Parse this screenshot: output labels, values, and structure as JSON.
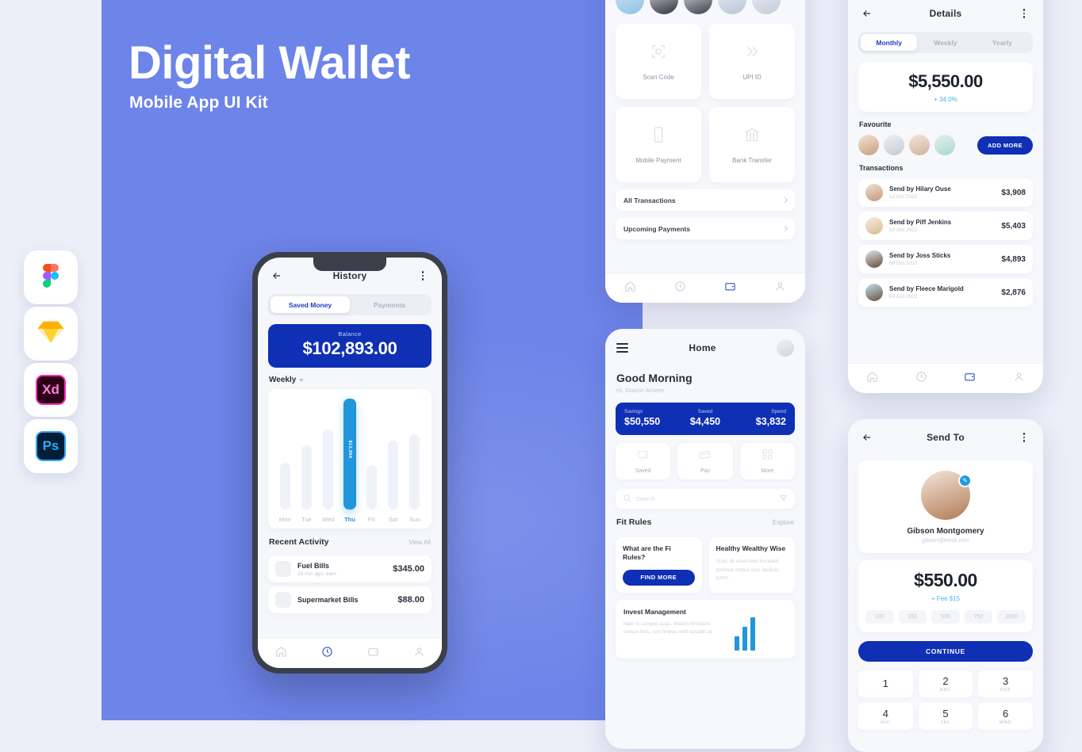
{
  "hero": {
    "title": "Digital Wallet",
    "subtitle": "Mobile App UI Kit",
    "bg_color": "#6d84e8",
    "accent_blue": "#0f2fb5",
    "accent_cyan": "#2196dd"
  },
  "tools": [
    {
      "name": "Figma",
      "icon": "figma-icon"
    },
    {
      "name": "Sketch",
      "icon": "sketch-icon"
    },
    {
      "name": "Adobe XD",
      "icon": "xd-icon",
      "label": "Xd"
    },
    {
      "name": "Photoshop",
      "icon": "photoshop-icon",
      "label": "Ps"
    }
  ],
  "history_screen": {
    "title": "History",
    "tabs": [
      {
        "label": "Saved Money",
        "active": true
      },
      {
        "label": "Payments",
        "active": false
      }
    ],
    "balance_label": "Balance",
    "balance_value": "$102,893.00",
    "period": "Weekly",
    "recent_title": "Recent Activity",
    "view_all": "View All",
    "activity": [
      {
        "name": "Fuel Bills",
        "sub": "24 min ago, earn",
        "amount": "$345.00"
      },
      {
        "name": "Supermarket Bills",
        "sub": "",
        "amount": "$88.00"
      }
    ],
    "nav": [
      "home-icon",
      "history-icon",
      "wallet-icon",
      "profile-icon"
    ],
    "active_nav": 1
  },
  "chart_data": {
    "type": "bar",
    "title": "Weekly",
    "categories": [
      "Mon",
      "Tue",
      "Wed",
      "Thu",
      "Fri",
      "Sat",
      "Sun"
    ],
    "values": [
      42,
      58,
      72,
      100,
      40,
      62,
      68
    ],
    "highlight_index": 3,
    "highlight_label": "$12,904",
    "xlabel": "",
    "ylabel": "",
    "grid": false,
    "legend": "none"
  },
  "payment_screen": {
    "tiles": [
      {
        "label": "Scan Code",
        "icon": "scan-code-icon"
      },
      {
        "label": "UPI ID",
        "icon": "chevrons-right-icon"
      },
      {
        "label": "Mobile Payment",
        "icon": "mobile-icon"
      },
      {
        "label": "Bank Transfer",
        "icon": "bank-icon"
      }
    ],
    "rows": [
      "All Transactions",
      "Upcoming Payments"
    ],
    "nav": [
      "home-icon",
      "history-icon",
      "wallet-icon",
      "profile-icon"
    ],
    "active_nav": 2
  },
  "home_screen": {
    "title": "Home",
    "greeting": "Good Morning",
    "user_line": "Hi, Dianne Ameter",
    "stats": [
      {
        "label": "Savings",
        "value": "$50,550"
      },
      {
        "label": "Saved",
        "value": "$4,450"
      },
      {
        "label": "Spend",
        "value": "$3,832"
      }
    ],
    "actions": [
      {
        "label": "Saved",
        "icon": "wallet-icon"
      },
      {
        "label": "Pay",
        "icon": "card-icon"
      },
      {
        "label": "More",
        "icon": "grid-icon"
      }
    ],
    "search_placeholder": "Search",
    "section_title": "Fit Rules",
    "section_link": "Explore",
    "cards": [
      {
        "title": "What are the Fi Rules?",
        "body": "",
        "button": "FIND MORE"
      },
      {
        "title": "Healthy Wealthy Wise",
        "body": "Nunc sit amet felis tincidunt, pulvinar metus sed, facilisis tortor."
      }
    ],
    "wide_card": {
      "title": "Invest Management",
      "body": "Nam in congue augu. Mauris tincidunt cursus felis, non finibus velit suscipit at"
    }
  },
  "details_screen": {
    "title": "Details",
    "tabs": [
      {
        "label": "Monthly",
        "active": true
      },
      {
        "label": "Weekly",
        "active": false
      },
      {
        "label": "Yearly",
        "active": false
      }
    ],
    "amount": "$5,550.00",
    "delta": "+ 34.0%",
    "favourite_label": "Favourite",
    "add_more": "ADD MORE",
    "transactions_label": "Transactions",
    "transactions": [
      {
        "name": "Send by Hilary Ouse",
        "date": "12 Oct 2022",
        "amount": "$3,908"
      },
      {
        "name": "Send by Piff Jenkins",
        "date": "10 Oct 2022",
        "amount": "$5,403"
      },
      {
        "name": "Send by Joss Sticks",
        "date": "08 Oct 2022",
        "amount": "$4,893"
      },
      {
        "name": "Send by Fleece Marigold",
        "date": "04 Oct 2022",
        "amount": "$2,876"
      }
    ],
    "nav": [
      "home-icon",
      "history-icon",
      "wallet-icon",
      "profile-icon"
    ],
    "active_nav": 2
  },
  "send_screen": {
    "title": "Send To",
    "contact_name": "Gibson Montgomery",
    "contact_email": "gibson@email.com",
    "amount": "$550.00",
    "fee": "+ Fee $15",
    "chips": [
      "100",
      "250",
      "500",
      "750",
      "1000"
    ],
    "continue": "CONTINUE",
    "keypad": [
      {
        "n": "1",
        "s": ""
      },
      {
        "n": "2",
        "s": "ABC"
      },
      {
        "n": "3",
        "s": "DEF"
      },
      {
        "n": "4",
        "s": "GHI"
      },
      {
        "n": "5",
        "s": "JKL"
      },
      {
        "n": "6",
        "s": "MNO"
      }
    ]
  }
}
